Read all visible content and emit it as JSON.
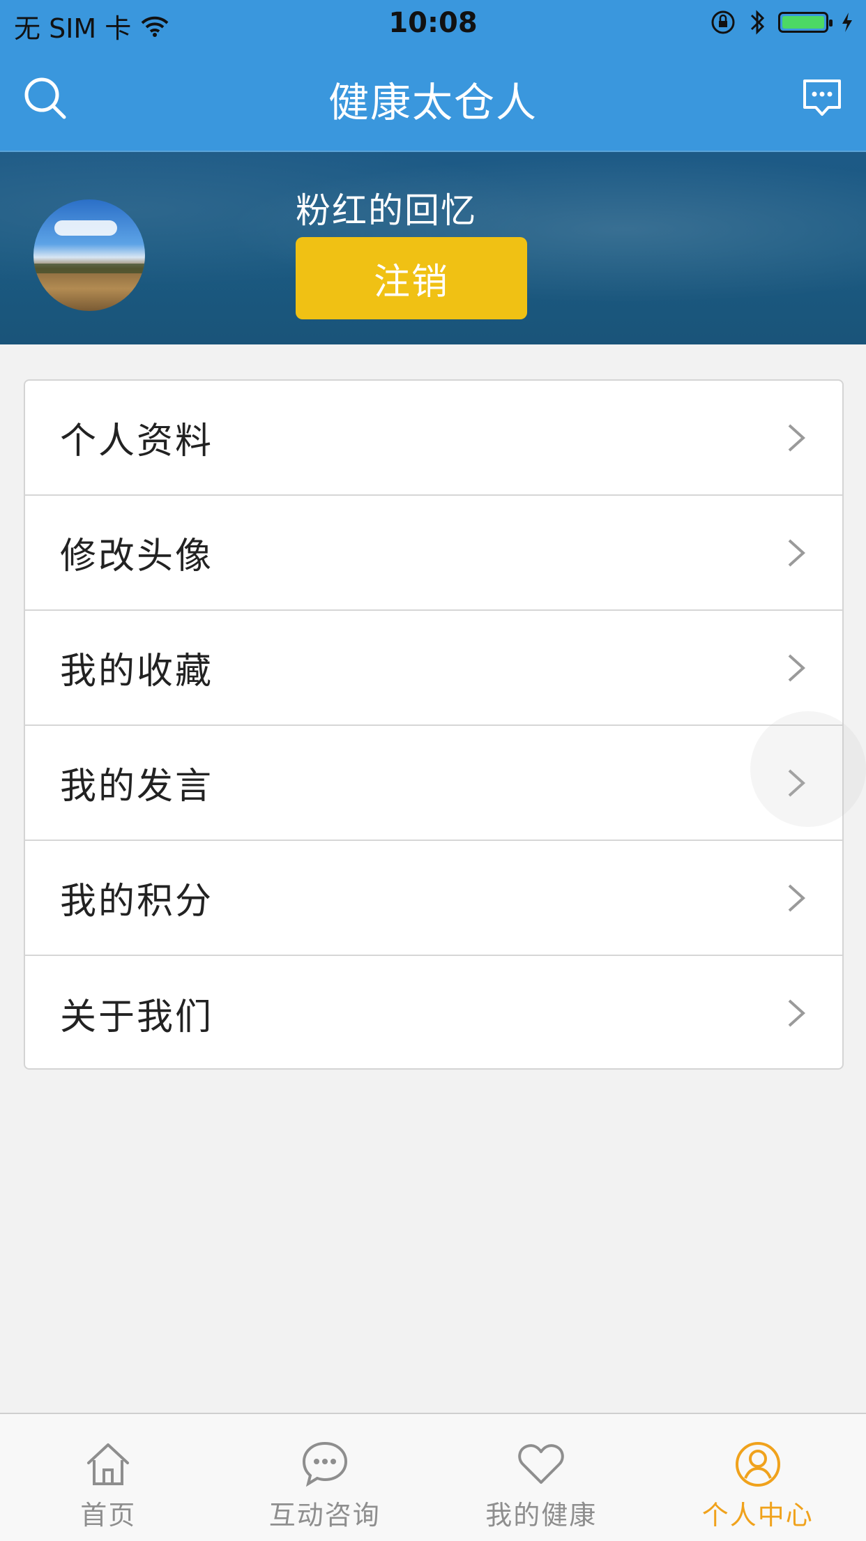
{
  "status_bar": {
    "carrier": "无 SIM 卡",
    "time": "10:08"
  },
  "header": {
    "title": "健康太仓人",
    "left_icon": "search-icon",
    "right_icon": "message-icon"
  },
  "profile": {
    "username": "粉红的回忆",
    "logout_label": "注销"
  },
  "menu": {
    "items": [
      {
        "label": "个人资料"
      },
      {
        "label": "修改头像"
      },
      {
        "label": "我的收藏"
      },
      {
        "label": "我的发言"
      },
      {
        "label": "我的积分"
      },
      {
        "label": "关于我们"
      }
    ]
  },
  "tabbar": {
    "tabs": [
      {
        "label": "首页",
        "icon": "home-icon"
      },
      {
        "label": "互动咨询",
        "icon": "chat-icon"
      },
      {
        "label": "我的健康",
        "icon": "heart-icon"
      },
      {
        "label": "个人中心",
        "icon": "user-icon",
        "active": true
      }
    ],
    "active_color": "#f0a21c"
  },
  "colors": {
    "header": "#3a97dd",
    "logout_button": "#f0c114"
  }
}
